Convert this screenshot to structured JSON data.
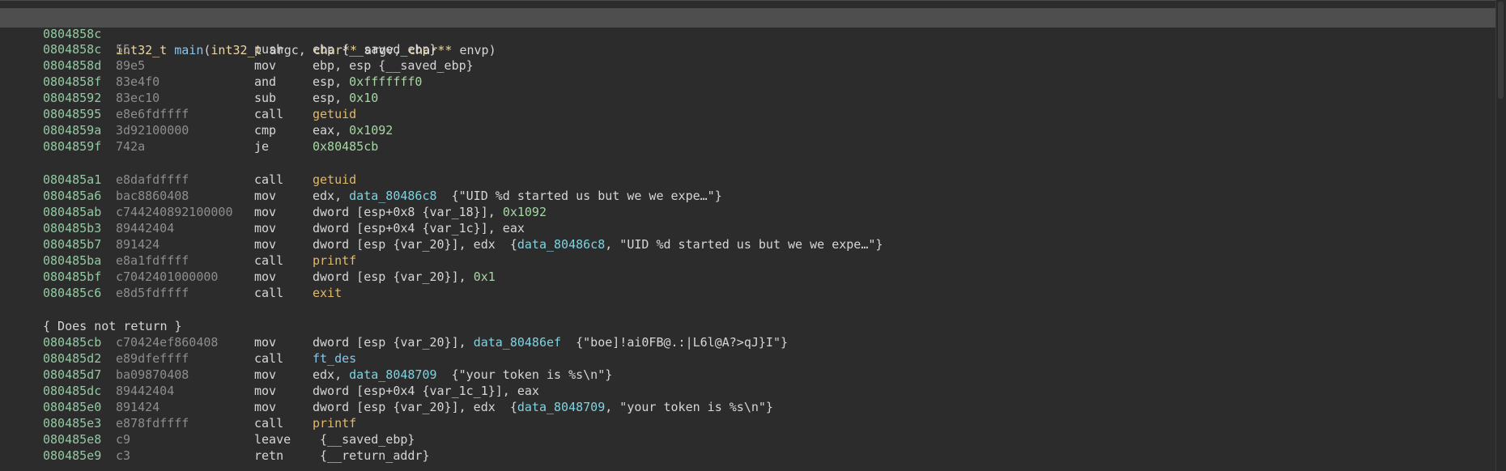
{
  "header": {
    "address": "0804858c",
    "return_type": "int32_t",
    "name": "main",
    "params_open": "(",
    "param1_type": "int32_t",
    "param1_name": " argc, ",
    "param2_type": "char**",
    "param2_name": " argv, ",
    "param3_type": "char**",
    "param3_name": " envp",
    "params_close": ")"
  },
  "block1": [
    {
      "addr": "0804858c",
      "bytes": "55",
      "mnem": "push",
      "ops": [
        [
          "reg",
          "ebp "
        ],
        [
          "var",
          "{__saved_ebp}"
        ]
      ]
    },
    {
      "addr": "0804858d",
      "bytes": "89e5",
      "mnem": "mov",
      "ops": [
        [
          "reg",
          "ebp, esp "
        ],
        [
          "var",
          "{__saved_ebp}"
        ]
      ]
    },
    {
      "addr": "0804858f",
      "bytes": "83e4f0",
      "mnem": "and",
      "ops": [
        [
          "reg",
          "esp, "
        ],
        [
          "num",
          "0xfffffff0"
        ]
      ]
    },
    {
      "addr": "08048592",
      "bytes": "83ec10",
      "mnem": "sub",
      "ops": [
        [
          "reg",
          "esp, "
        ],
        [
          "num",
          "0x10"
        ]
      ]
    },
    {
      "addr": "08048595",
      "bytes": "e8e6fdffff",
      "mnem": "call",
      "ops": [
        [
          "sym",
          "getuid"
        ]
      ]
    },
    {
      "addr": "0804859a",
      "bytes": "3d92100000",
      "mnem": "cmp",
      "ops": [
        [
          "reg",
          "eax, "
        ],
        [
          "num",
          "0x1092"
        ]
      ]
    },
    {
      "addr": "0804859f",
      "bytes": "742a",
      "mnem": "je",
      "ops": [
        [
          "num",
          "0x80485cb"
        ]
      ]
    }
  ],
  "block2": [
    {
      "addr": "080485a1",
      "bytes": "e8dafdffff",
      "mnem": "call",
      "ops": [
        [
          "sym",
          "getuid"
        ]
      ]
    },
    {
      "addr": "080485a6",
      "bytes": "bac8860408",
      "mnem": "mov",
      "ops": [
        [
          "reg",
          "edx, "
        ],
        [
          "dat",
          "data_80486c8"
        ],
        [
          "str",
          "  {\"UID %d started us but we we expe…\"}"
        ]
      ]
    },
    {
      "addr": "080485ab",
      "bytes": "c744240892100000",
      "mnem": "mov",
      "ops": [
        [
          "plain",
          "dword [esp+0x8 {var_18}], "
        ],
        [
          "num",
          "0x1092"
        ]
      ]
    },
    {
      "addr": "080485b3",
      "bytes": "89442404",
      "mnem": "mov",
      "ops": [
        [
          "plain",
          "dword [esp+0x4 {var_1c}], eax"
        ]
      ]
    },
    {
      "addr": "080485b7",
      "bytes": "891424",
      "mnem": "mov",
      "ops": [
        [
          "plain",
          "dword [esp {var_20}], edx  {"
        ],
        [
          "dat",
          "data_80486c8"
        ],
        [
          "str",
          ", \"UID %d started us but we we expe…\"}"
        ]
      ]
    },
    {
      "addr": "080485ba",
      "bytes": "e8a1fdffff",
      "mnem": "call",
      "ops": [
        [
          "sym",
          "printf"
        ]
      ]
    },
    {
      "addr": "080485bf",
      "bytes": "c7042401000000",
      "mnem": "mov",
      "ops": [
        [
          "plain",
          "dword [esp {var_20}], "
        ],
        [
          "num",
          "0x1"
        ]
      ]
    },
    {
      "addr": "080485c6",
      "bytes": "e8d5fdffff",
      "mnem": "call",
      "ops": [
        [
          "sym",
          "exit"
        ]
      ]
    }
  ],
  "no_return_note": "{ Does not return }",
  "block3": [
    {
      "addr": "080485cb",
      "bytes": "c70424ef860408",
      "mnem": "mov",
      "ops": [
        [
          "plain",
          "dword [esp {var_20}], "
        ],
        [
          "dat",
          "data_80486ef"
        ],
        [
          "str",
          "  {\"boe]!ai0FB@.:|L6l@A?>qJ}I\"}"
        ]
      ]
    },
    {
      "addr": "080485d2",
      "bytes": "e89dfeffff",
      "mnem": "call",
      "ops": [
        [
          "fn",
          "ft_des"
        ]
      ]
    },
    {
      "addr": "080485d7",
      "bytes": "ba09870408",
      "mnem": "mov",
      "ops": [
        [
          "reg",
          "edx, "
        ],
        [
          "dat",
          "data_8048709"
        ],
        [
          "str",
          "  {\"your token is %s\\n\"}"
        ]
      ]
    },
    {
      "addr": "080485dc",
      "bytes": "89442404",
      "mnem": "mov",
      "ops": [
        [
          "plain",
          "dword [esp+0x4 {var_1c_1}], eax"
        ]
      ]
    },
    {
      "addr": "080485e0",
      "bytes": "891424",
      "mnem": "mov",
      "ops": [
        [
          "plain",
          "dword [esp {var_20}], edx  {"
        ],
        [
          "dat",
          "data_8048709"
        ],
        [
          "str",
          ", \"your token is %s\\n\"}"
        ]
      ]
    },
    {
      "addr": "080485e3",
      "bytes": "e878fdffff",
      "mnem": "call",
      "ops": [
        [
          "sym",
          "printf"
        ]
      ]
    },
    {
      "addr": "080485e8",
      "bytes": "c9",
      "mnem": "leave",
      "ops": [
        [
          "var",
          " {__saved_ebp}"
        ]
      ]
    },
    {
      "addr": "080485e9",
      "bytes": "c3",
      "mnem": "retn",
      "ops": [
        [
          "var",
          " {__return_addr}"
        ]
      ]
    }
  ],
  "colors": {
    "background": "#2c2c2c",
    "header_bar": "#4e4e4e",
    "address": "#93c9a2",
    "bytes": "#8d8d8d",
    "symbol": "#e2b86b",
    "function_name": "#87c6ee",
    "number": "#a6d8a3",
    "data_ref": "#7fd3e0",
    "type_keyword": "#ecd7a3"
  }
}
